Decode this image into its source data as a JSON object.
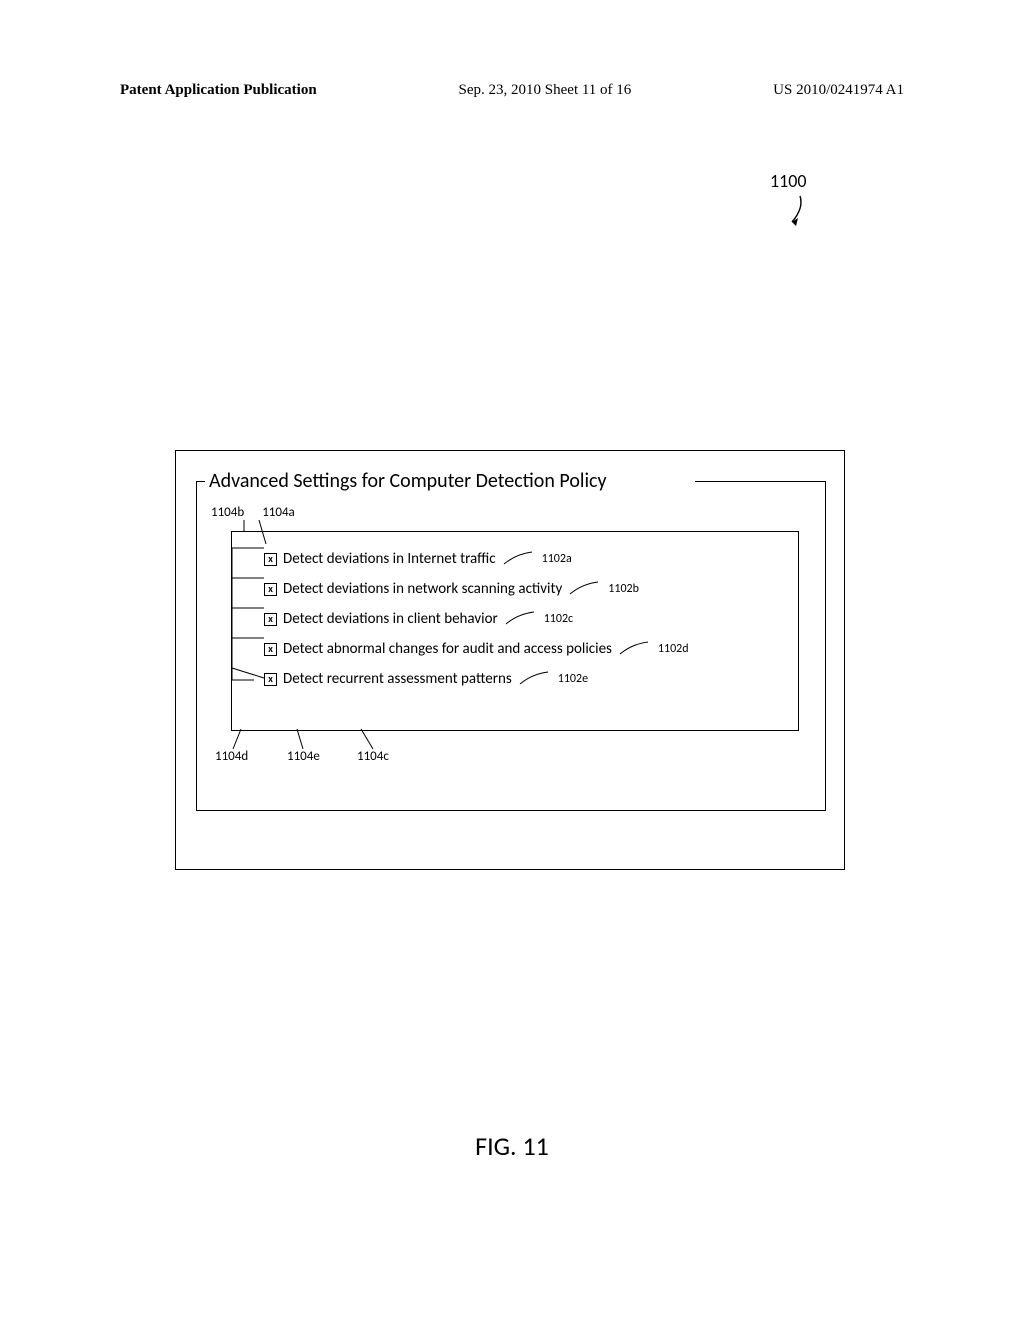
{
  "header": {
    "left": "Patent Application Publication",
    "center": "Sep. 23, 2010  Sheet 11 of 16",
    "right": "US 2010/0241974 A1"
  },
  "root_ref": "1100",
  "figure_caption": "FIG. 11",
  "fieldset_legend": "Advanced Settings for Computer Detection Policy",
  "leader_top_labels": {
    "b": "1104b",
    "a": "1104a"
  },
  "options": [
    {
      "label": "Detect deviations in Internet traffic",
      "ref": "1102a",
      "checked": true
    },
    {
      "label": "Detect deviations in network scanning activity",
      "ref": "1102b",
      "checked": true
    },
    {
      "label": "Detect deviations in client behavior",
      "ref": "1102c",
      "checked": true
    },
    {
      "label": "Detect abnormal changes for audit and access policies",
      "ref": "1102d",
      "checked": true
    },
    {
      "label": "Detect recurrent assessment patterns",
      "ref": "1102e",
      "checked": true
    }
  ],
  "bottom_labels": {
    "d": "1104d",
    "e": "1104e",
    "c": "1104c"
  }
}
